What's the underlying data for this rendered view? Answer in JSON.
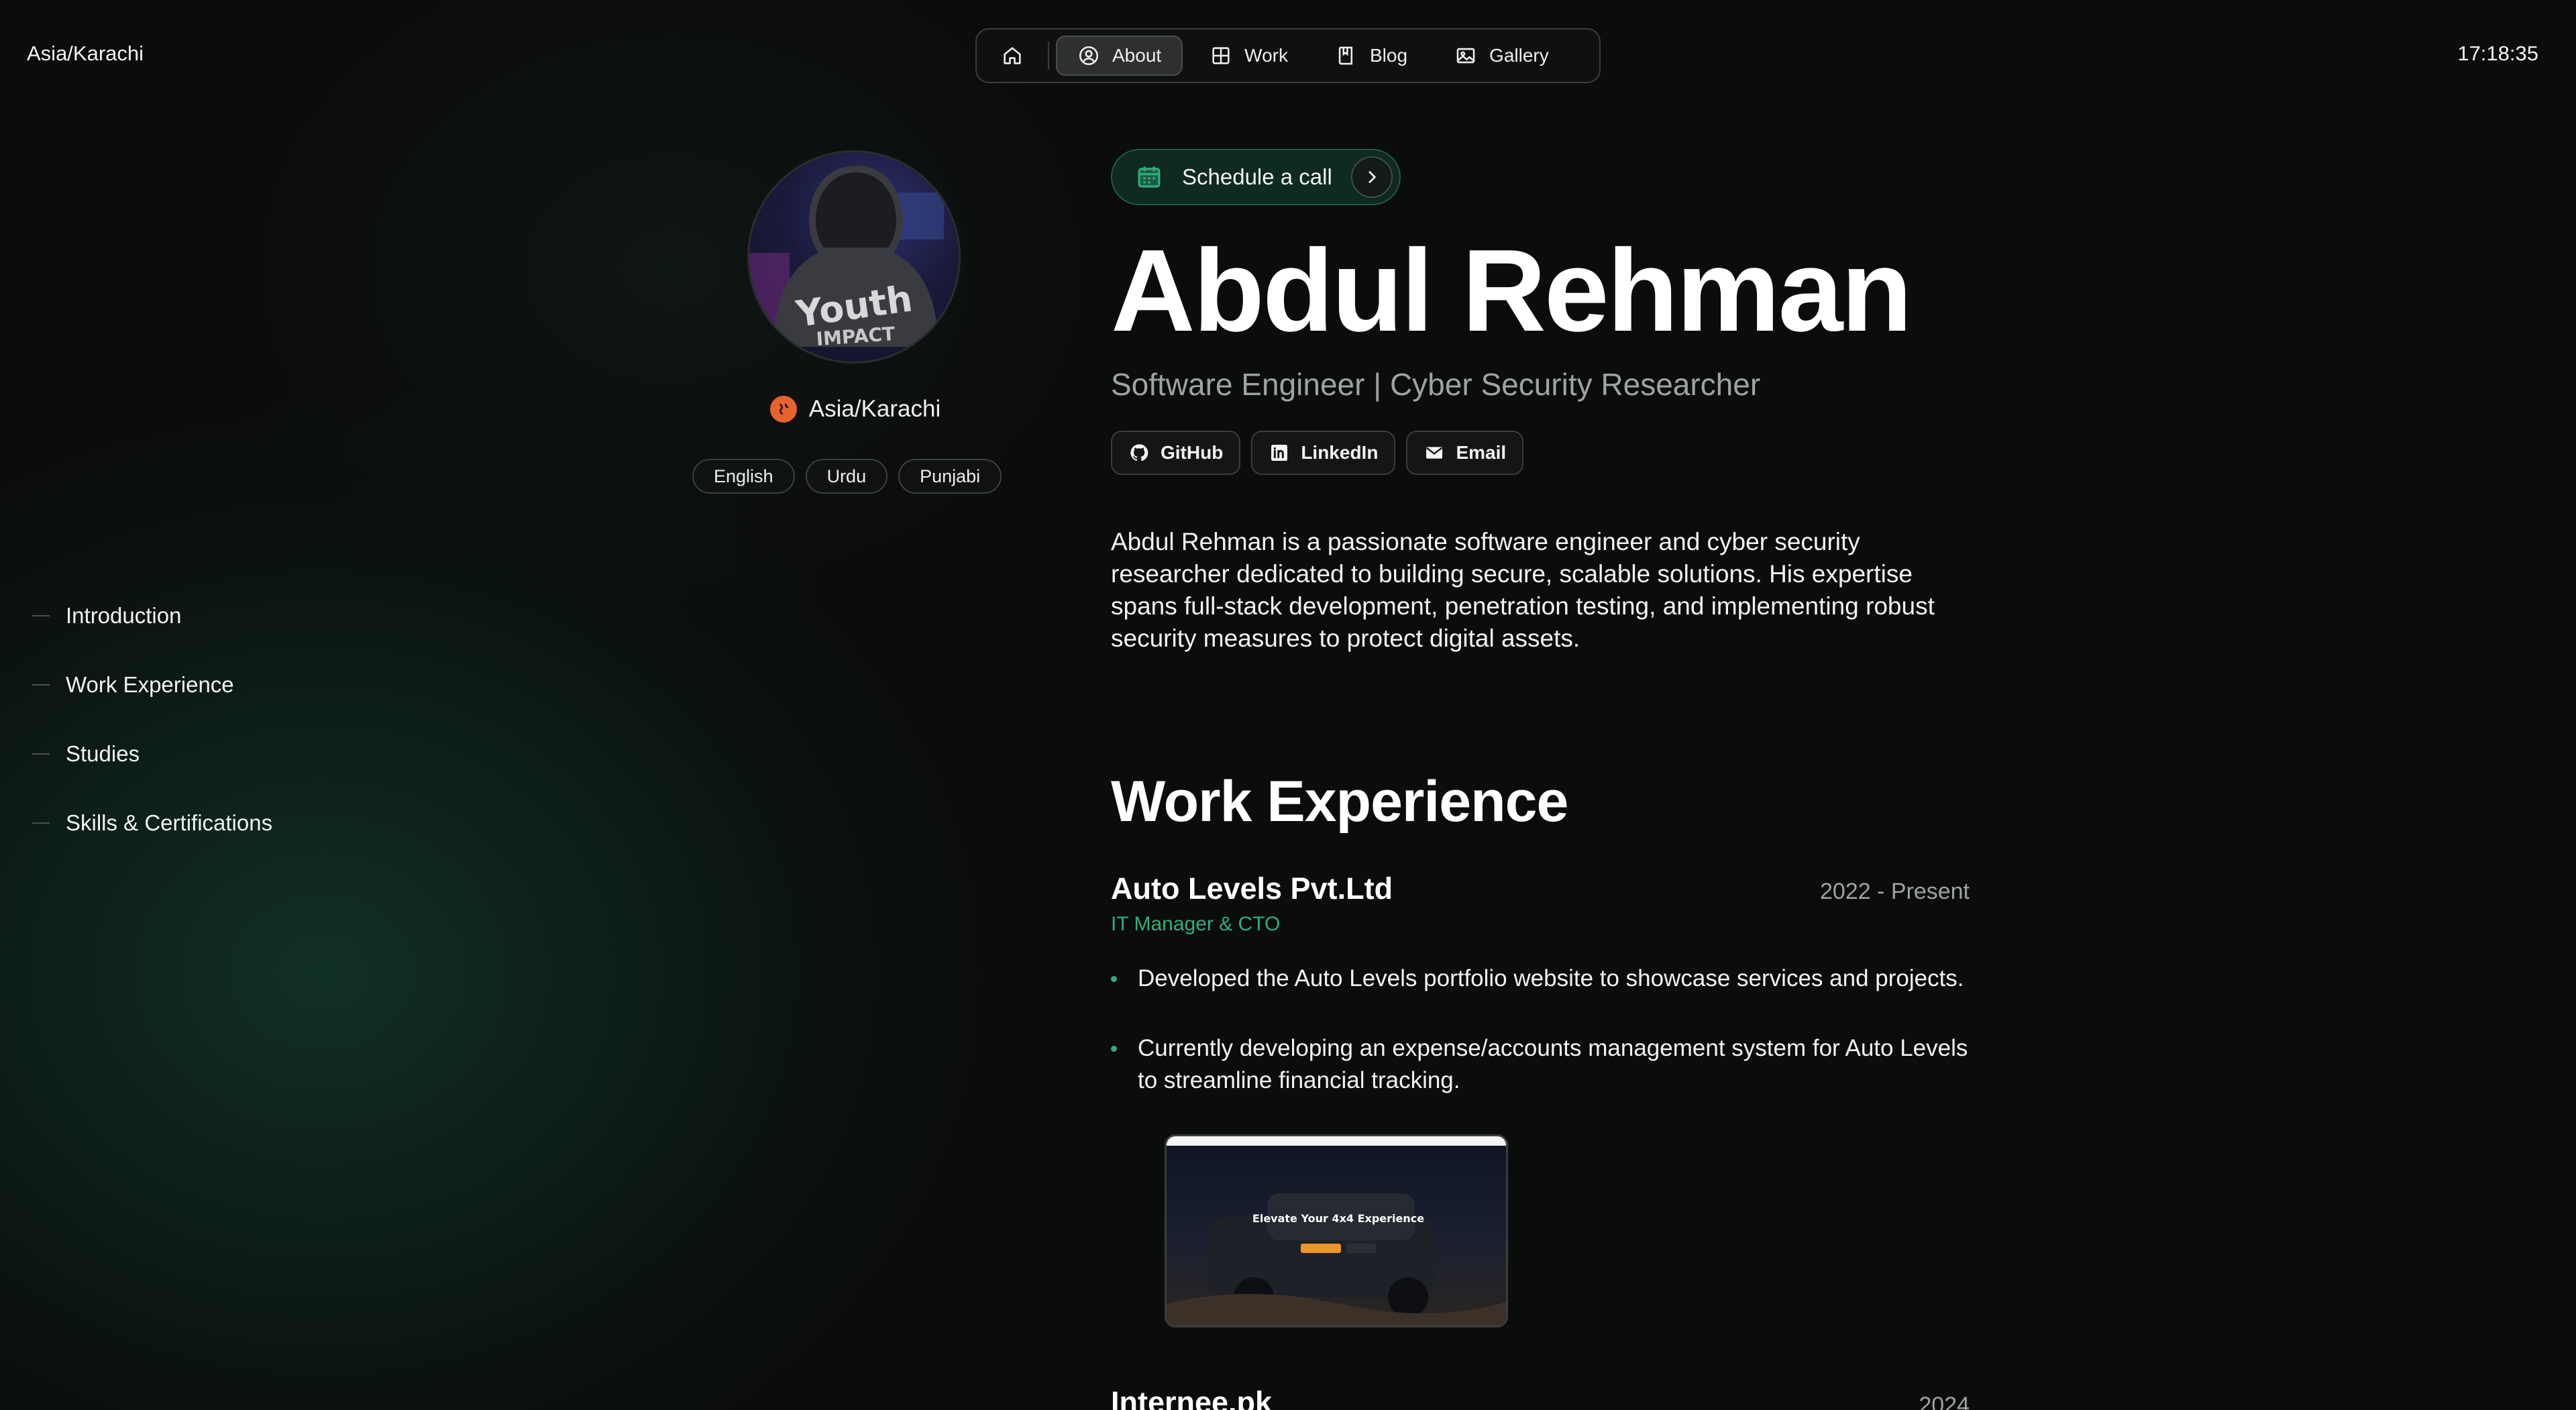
{
  "topbar": {
    "timezone": "Asia/Karachi",
    "clock": "17:18:35"
  },
  "nav": {
    "items": [
      {
        "label": "",
        "icon": "home-icon"
      },
      {
        "label": "About",
        "icon": "user-circle-icon",
        "active": true
      },
      {
        "label": "Work",
        "icon": "grid-icon"
      },
      {
        "label": "Blog",
        "icon": "book-icon"
      },
      {
        "label": "Gallery",
        "icon": "image-icon"
      }
    ]
  },
  "profile": {
    "location": "Asia/Karachi",
    "languages": [
      "English",
      "Urdu",
      "Punjabi"
    ],
    "avatar_text": "Youth IMPACT"
  },
  "toc": [
    "Introduction",
    "Work Experience",
    "Studies",
    "Skills & Certifications"
  ],
  "hero": {
    "schedule_label": "Schedule a call",
    "name": "Abdul Rehman",
    "role": "Software Engineer | Cyber Security Researcher",
    "socials": [
      "GitHub",
      "LinkedIn",
      "Email"
    ],
    "intro": "Abdul Rehman is a passionate software engineer and cyber security researcher dedicated to building secure, scalable solutions. His expertise spans full-stack development, penetration testing, and implementing robust security measures to protect digital assets."
  },
  "work": {
    "heading": "Work Experience",
    "jobs": [
      {
        "company": "Auto Levels Pvt.Ltd",
        "dates": "2022 - Present",
        "role": "IT Manager & CTO",
        "bullets": [
          "Developed the Auto Levels portfolio website to showcase services and projects.",
          "Currently developing an expense/accounts management system for Auto Levels to streamline financial tracking."
        ],
        "image_headline": "Elevate Your 4x4 Experience"
      },
      {
        "company": "Internee.pk",
        "dates": "2024"
      }
    ]
  },
  "colors": {
    "accent": "#2fae7c",
    "background": "#0b0c0c",
    "muted": "#9fa3a1"
  }
}
